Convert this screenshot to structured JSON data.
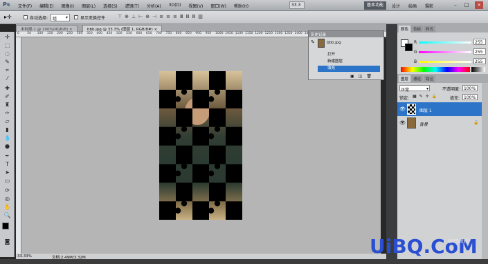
{
  "menubar": {
    "logo": "Ps",
    "items": [
      "文件(F)",
      "编辑(E)",
      "图像(I)",
      "图层(L)",
      "选择(S)",
      "滤镜(T)",
      "分析(A)",
      "3D(D)",
      "视图(V)",
      "窗口(W)",
      "帮助(H)"
    ],
    "zoom": "33.3",
    "workspace_active": "基本功能",
    "workspaces": [
      "设计",
      "绘画",
      "摄影"
    ]
  },
  "options": {
    "auto_select_label": "自动选择:",
    "auto_select_value": "组",
    "show_transform_label": "显示变换控件"
  },
  "tabs": [
    {
      "label": "未标题-1 @ 100%(RGB/8) ×"
    },
    {
      "label": "bbb.jpg @ 33.3% (图层 1, RGB/8#) ×"
    }
  ],
  "ruler_ticks": [
    "0",
    "50",
    "100",
    "150",
    "200",
    "250",
    "300",
    "350",
    "400",
    "450",
    "500",
    "550",
    "600",
    "650",
    "700",
    "750",
    "800",
    "850",
    "900",
    "950",
    "1000",
    "1050",
    "1100",
    "1150",
    "1200",
    "1250",
    "1300",
    "1350",
    "1400",
    "1450",
    "1500",
    "1550",
    "1600",
    "1650",
    "1700",
    "1750",
    "1800"
  ],
  "status": {
    "zoom": "33.33%",
    "doc": "文档:2.49M/3.32M"
  },
  "history": {
    "title": "历史记录",
    "snapshot": "bbb.jpg",
    "items": [
      "打开",
      "新建图层",
      "填充"
    ]
  },
  "color_panel": {
    "tabs": [
      "颜色",
      "色板",
      "样式"
    ],
    "r_label": "R",
    "g_label": "G",
    "b_label": "B",
    "r_value": "255",
    "g_value": "255",
    "b_value": "255"
  },
  "layers_panel": {
    "tabs": [
      "图层",
      "通道",
      "路径"
    ],
    "blend_mode": "正常",
    "opacity_label": "不透明度:",
    "opacity_value": "100%",
    "lock_label": "锁定:",
    "fill_label": "填充:",
    "fill_value": "100%",
    "layers": [
      {
        "name": "图层 1",
        "selected": true
      },
      {
        "name": "背景",
        "selected": false
      }
    ]
  },
  "watermark": {
    "main": "UiBQ.CoM",
    "sub": "@PS教程"
  },
  "colors": {
    "selection_blue": "#2b74c7",
    "watermark_blue": "#2a4fd3"
  }
}
